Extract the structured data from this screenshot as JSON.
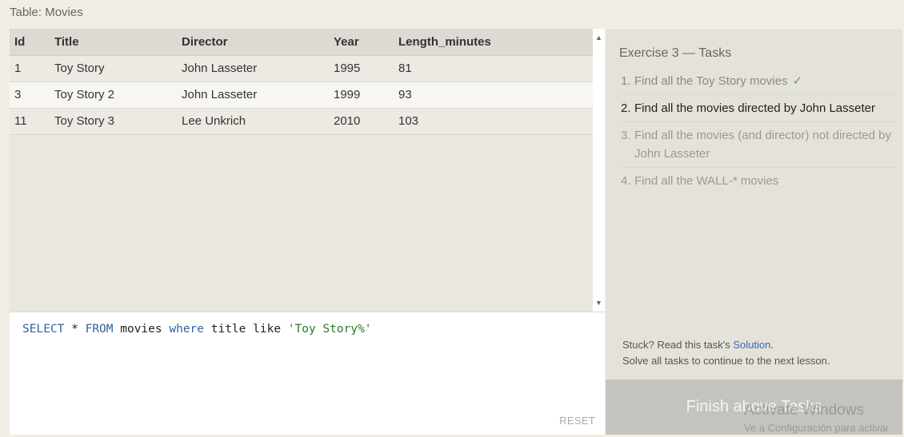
{
  "table_label": "Table: Movies",
  "results": {
    "columns": [
      "Id",
      "Title",
      "Director",
      "Year",
      "Length_minutes"
    ],
    "rows": [
      [
        "1",
        "Toy Story",
        "John Lasseter",
        "1995",
        "81"
      ],
      [
        "3",
        "Toy Story 2",
        "John Lasseter",
        "1999",
        "93"
      ],
      [
        "11",
        "Toy Story 3",
        "Lee Unkrich",
        "2010",
        "103"
      ]
    ]
  },
  "editor": {
    "kw_select": "SELECT",
    "star": " * ",
    "kw_from": "FROM",
    "table": " movies ",
    "kw_where": "where",
    "rest": " title like ",
    "string": "'Toy Story%'",
    "reset_label": "RESET"
  },
  "exercise": {
    "title": "Exercise 3 — Tasks",
    "tasks": [
      {
        "num": "1.",
        "text": "Find all the Toy Story movies",
        "check": "✓"
      },
      {
        "num": "2.",
        "text": "Find all the movies directed by John Lasseter"
      },
      {
        "num": "3.",
        "text": "Find all the movies (and director) not directed by John Lasseter"
      },
      {
        "num": "4.",
        "text": "Find all the WALL-* movies"
      }
    ],
    "help_prefix": "Stuck? Read this task's ",
    "help_link": "Solution",
    "help_suffix": ".",
    "help_line2": "Solve all tasks to continue to the next lesson.",
    "finish_label": "Finish above Tasks"
  },
  "watermark": {
    "title": "Activate Windows",
    "subtitle": "Ve a Configuración para activar"
  },
  "colors": {
    "accent_link": "#2e6ac2",
    "keyword": "#3461a0",
    "string": "#2a7a2a",
    "check": "#5aa55a"
  }
}
